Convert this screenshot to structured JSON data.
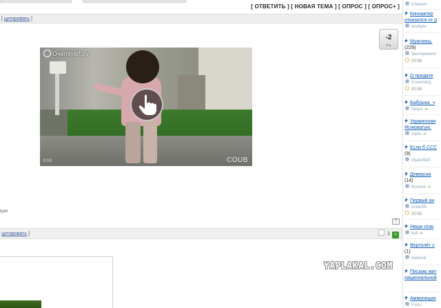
{
  "topic_actions": {
    "reply": "ОТВЕТИТЬ",
    "new_topic": "НОВАЯ ТЕМА",
    "poll": "ОПРОС",
    "poll_plus": "ОПРОС+"
  },
  "post1": {
    "quote_link": "цитировать",
    "rating": "-2",
    "video": {
      "channel": "ОчепяткИ.ру",
      "time": "0:10",
      "brand": "COUB"
    },
    "author_fragment": "tyan"
  },
  "post2": {
    "quote_link": "цитировать",
    "rating_value": "1",
    "scroll_top": "^"
  },
  "watermark": "YAPLAKAL.COM",
  "sidebar": [
    {
      "title": "",
      "meta": "Chitaem",
      "time": ""
    },
    {
      "title": "Киноактер",
      "line2": "отказался от р",
      "meta": "terabyte",
      "time": ""
    },
    {
      "title": "Мужчины,",
      "count": "(229)",
      "meta": "Эксперемент",
      "time": "20:58"
    },
    {
      "title": "О предате",
      "meta": "GraveVarg",
      "time": "20:58"
    },
    {
      "title": "Бабушка, ч",
      "meta": "Sequs",
      "time": ""
    },
    {
      "title": "Украинская",
      "line2": "Яснюватую.",
      "meta": "melto",
      "time": ""
    },
    {
      "title": "Если б ССС",
      "count": "(9)",
      "meta": "Иракобеб",
      "time": ""
    },
    {
      "title": "Деверски",
      "count": "(14)",
      "meta": "Bronto3",
      "time": ""
    },
    {
      "title": "Первый ан",
      "meta": "ender98",
      "time": "20:58"
    },
    {
      "title": "Няши отак",
      "meta": "kott",
      "time": ""
    },
    {
      "title": "Вертолёт с",
      "count": "(1)",
      "meta": "walenok",
      "time": ""
    },
    {
      "title": "Письмо жит",
      "line2": "национальной",
      "meta": "",
      "time": ""
    },
    {
      "title": "Аммуниция",
      "meta": "Fosto",
      "time": ""
    }
  ]
}
